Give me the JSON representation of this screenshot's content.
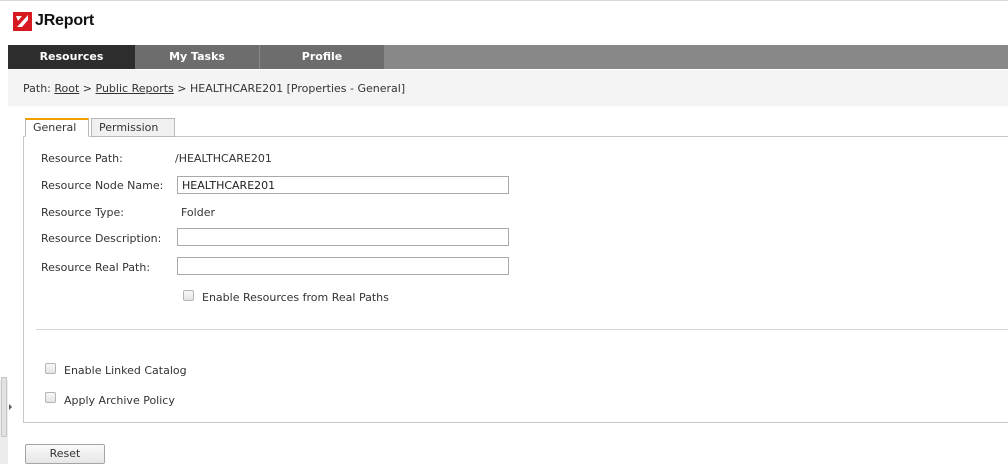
{
  "app": {
    "title": "JReport",
    "logo_icon": "jreport-logo-icon",
    "brand_color": "#d71920"
  },
  "nav": {
    "tabs": [
      {
        "label": "Resources"
      },
      {
        "label": "My Tasks"
      },
      {
        "label": "Profile"
      }
    ]
  },
  "breadcrumb": {
    "prefix": "Path:",
    "root": "Root",
    "sep1": ">",
    "public": "Public Reports",
    "sep2": ">",
    "current": "HEALTHCARE201 [Properties - General]"
  },
  "tabs": [
    {
      "label": "General"
    },
    {
      "label": "Permission"
    }
  ],
  "form": {
    "resource_path_label": "Resource Path:",
    "resource_path_value": "/HEALTHCARE201",
    "node_name_label": "Resource Node Name:",
    "node_name_value": "HEALTHCARE201",
    "type_label": "Resource Type:",
    "type_value": "Folder",
    "description_label": "Resource Description:",
    "description_value": "",
    "real_path_label": "Resource Real Path:",
    "real_path_value": "",
    "enable_real_paths_label": "Enable Resources from Real Paths",
    "enable_linked_catalog_label": "Enable Linked Catalog",
    "apply_archive_policy_label": "Apply Archive Policy"
  },
  "buttons": {
    "reset_label": "Reset"
  }
}
